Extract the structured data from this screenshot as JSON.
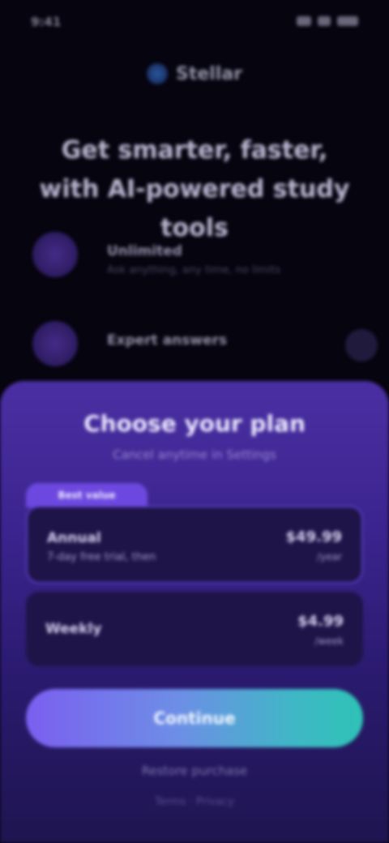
{
  "status_bar": {
    "time": "9:41"
  },
  "header": {
    "brand": "Stellar"
  },
  "headline": "Get smarter, faster, with AI-powered study tools",
  "features": [
    {
      "title": "Unlimited",
      "subtitle": "Ask anything, any time, no limits"
    },
    {
      "title": "Expert answers",
      "subtitle": ""
    }
  ],
  "sheet": {
    "title": "Choose your plan",
    "subtitle": "Cancel anytime in Settings",
    "badge": "Best value",
    "plans": [
      {
        "name": "Annual",
        "desc": "7-day free trial, then",
        "price": "$49.99",
        "period": "/year"
      },
      {
        "name": "Weekly",
        "desc": "",
        "price": "$4.99",
        "period": "/week"
      }
    ],
    "cta": "Continue",
    "footer": "Restore purchase",
    "footer2": "Terms · Privacy"
  }
}
